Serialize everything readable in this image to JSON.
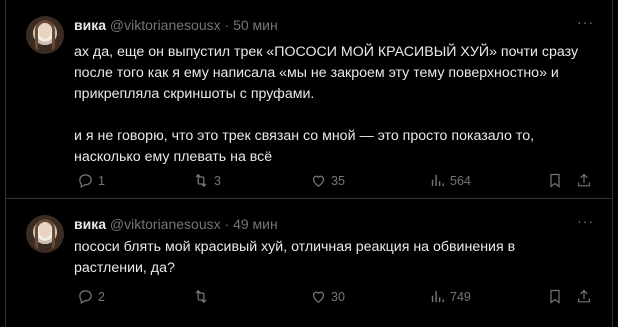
{
  "tweets": [
    {
      "author": "вика",
      "handle": "@viktorianesousx",
      "separator": "·",
      "time": "50 мин",
      "more": "···",
      "paragraphs": [
        "ах да, еще он выпустил трек «ПОСОСИ МОЙ КРАСИВЫЙ ХУЙ» почти сразу\nпосле того как я ему написала «мы не закроем эту тему поверхностно» и\nприкрепляла скриншоты с пруфами.",
        "и я не говорю, что это трек связан со мной — это просто показало то,\nнасколько ему плевать на всё"
      ],
      "stats": {
        "replies": "1",
        "retweets": "3",
        "likes": "35",
        "views": "564"
      }
    },
    {
      "author": "вика",
      "handle": "@viktorianesousx",
      "separator": "·",
      "time": "49 мин",
      "more": "···",
      "paragraphs": [
        "пососи блять мой красивый хуй, отличная реакция на обвинения в\nрастлении, да?"
      ],
      "stats": {
        "replies": "2",
        "retweets": "",
        "likes": "30",
        "views": "749"
      }
    }
  ],
  "colors": {
    "background": "#000000",
    "text": "#e7e9ea",
    "muted": "#71767b",
    "divider": "#2f3336"
  },
  "icons": [
    "reply-icon",
    "retweet-icon",
    "like-icon",
    "views-icon",
    "bookmark-icon",
    "share-icon"
  ]
}
